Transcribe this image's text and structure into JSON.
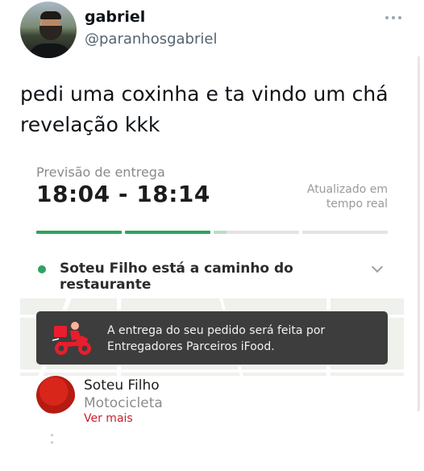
{
  "tweet": {
    "display_name": "gabriel",
    "handle": "@paranhosgabriel",
    "text": "pedi uma coxinha e ta vindo um chá revelação kkk",
    "more_icon": "more-horizontal-icon"
  },
  "delivery": {
    "eta_label": "Previsão de entrega",
    "eta_value": "18:04 - 18:14",
    "updated_line1": "Atualizado em",
    "updated_line2": "tempo real",
    "progress": {
      "segments": 4,
      "completed": 2,
      "current_partial": 0.15
    },
    "status_text": "Soteu Filho está a caminho do restaurante",
    "notice": "A entrega do seu pedido será feita por Entregadores Parceiros iFood.",
    "driver": {
      "name": "Soteu Filho",
      "vehicle": "Motocicleta",
      "see_more": "Ver mais"
    },
    "colors": {
      "accent_green": "#2fa35f",
      "brand_red": "#c8202b",
      "notice_bg": "#3d3d3d"
    }
  }
}
